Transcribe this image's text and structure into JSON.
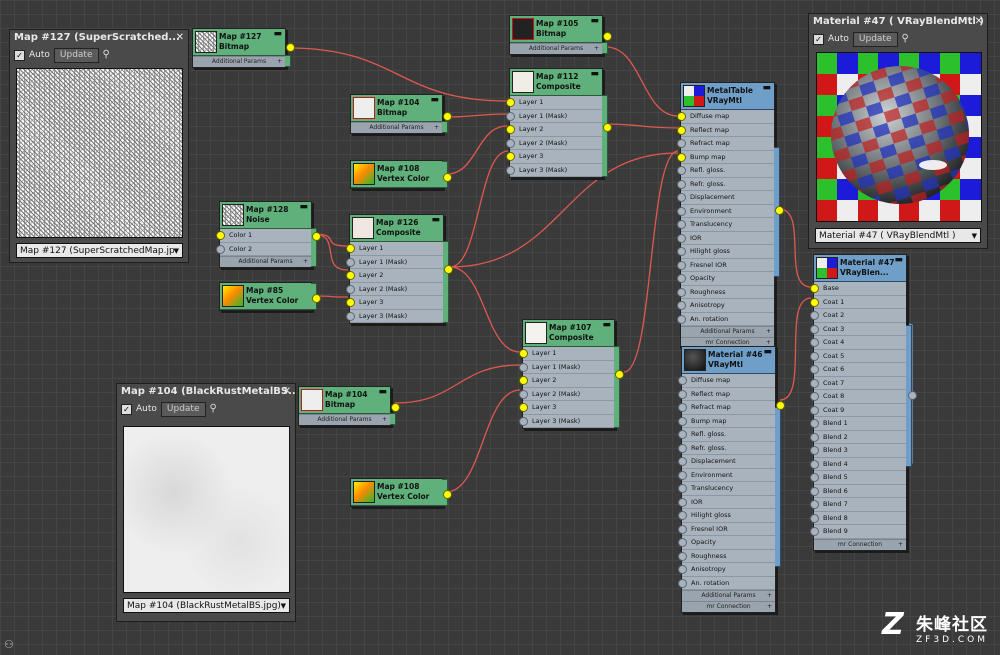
{
  "panels": {
    "p127": {
      "title": "Map #127 (SuperScratched...",
      "auto": "Auto",
      "update": "Update",
      "dropdown": "Map #127 (SuperScratchedMap.jp"
    },
    "p104": {
      "title": "Map #104 (BlackRustMetalBS...",
      "auto": "Auto",
      "update": "Update",
      "dropdown": "Map #104 (BlackRustMetalBS.jpg)"
    },
    "p47": {
      "title": "Material #47  ( VRayBlendMtl )",
      "auto": "Auto",
      "update": "Update",
      "dropdown": "Material #47  ( VRayBlendMtl )"
    }
  },
  "nodes": {
    "bitmap127": {
      "t1": "Map #127",
      "t2": "Bitmap",
      "foot": "Additional Params"
    },
    "bitmap105": {
      "t1": "Map #105",
      "t2": "Bitmap",
      "foot": "Additional Params"
    },
    "bitmap104a": {
      "t1": "Map #104",
      "t2": "Bitmap",
      "foot": "Additional Params"
    },
    "bitmap104b": {
      "t1": "Map #104",
      "t2": "Bitmap",
      "foot": "Additional Params"
    },
    "vc108a": {
      "t1": "Map #108",
      "t2": "Vertex Color"
    },
    "vc108b": {
      "t1": "Map #108",
      "t2": "Vertex Color"
    },
    "vc85": {
      "t1": "Map #85",
      "t2": "Vertex Color"
    },
    "noise128": {
      "t1": "Map #128",
      "t2": "Noise",
      "slots": [
        "Color 1",
        "Color 2"
      ],
      "foot": "Additional Params"
    },
    "comp112": {
      "t1": "Map #112",
      "t2": "Composite",
      "slots": [
        "Layer 1",
        "Layer 1 (Mask)",
        "Layer 2",
        "Layer 2 (Mask)",
        "Layer 3",
        "Layer 3 (Mask)"
      ]
    },
    "comp126": {
      "t1": "Map #126",
      "t2": "Composite",
      "slots": [
        "Layer 1",
        "Layer 1 (Mask)",
        "Layer 2",
        "Layer 2 (Mask)",
        "Layer 3",
        "Layer 3 (Mask)"
      ]
    },
    "comp107": {
      "t1": "Map #107",
      "t2": "Composite",
      "slots": [
        "Layer 1",
        "Layer 1 (Mask)",
        "Layer 2",
        "Layer 2 (Mask)",
        "Layer 3",
        "Layer 3 (Mask)"
      ]
    },
    "metaltable": {
      "t1": "MetalTable",
      "t2": "VRayMtl",
      "slots": [
        "Diffuse map",
        "Reflect map",
        "Refract map",
        "Bump map",
        "Refl. gloss.",
        "Refr. gloss.",
        "Displacement",
        "Environment",
        "Translucency",
        "IOR",
        "Hilight gloss",
        "Fresnel IOR",
        "Opacity",
        "Roughness",
        "Anisotropy",
        "An. rotation"
      ],
      "foot1": "Additional Params",
      "foot2": "mr Connection"
    },
    "mat46": {
      "t1": "Material #46",
      "t2": "VRayMtl",
      "slots": [
        "Diffuse map",
        "Reflect map",
        "Refract map",
        "Bump map",
        "Refl. gloss.",
        "Refr. gloss.",
        "Displacement",
        "Environment",
        "Translucency",
        "IOR",
        "Hilight gloss",
        "Fresnel IOR",
        "Opacity",
        "Roughness",
        "Anisotropy",
        "An. rotation"
      ],
      "foot1": "Additional Params",
      "foot2": "mr Connection"
    },
    "mat47": {
      "t1": "Material #47",
      "t2": "VRayBlen...",
      "slots": [
        "Base",
        "Coat 1",
        "Coat 2",
        "Coat 3",
        "Coat 4",
        "Coat 5",
        "Coat 6",
        "Coat 7",
        "Coat 8",
        "Coat 9",
        "Blend 1",
        "Blend 2",
        "Blend 3",
        "Blend 4",
        "Blend 5",
        "Blend 6",
        "Blend 7",
        "Blend 8",
        "Blend 9"
      ],
      "foot": "mr Connection"
    }
  },
  "watermark": {
    "zh": "朱峰社区",
    "en": "ZF3D.COM"
  },
  "colors": {
    "map_header": "#5fb07a",
    "mtl_header": "#6f9fc8",
    "wire": "#e0584f",
    "port_active": "#ffff00"
  },
  "icons": {
    "minimize": "minimize-icon",
    "close": "close-icon",
    "filter": "filter-icon",
    "binoculars": "binoculars-icon"
  }
}
